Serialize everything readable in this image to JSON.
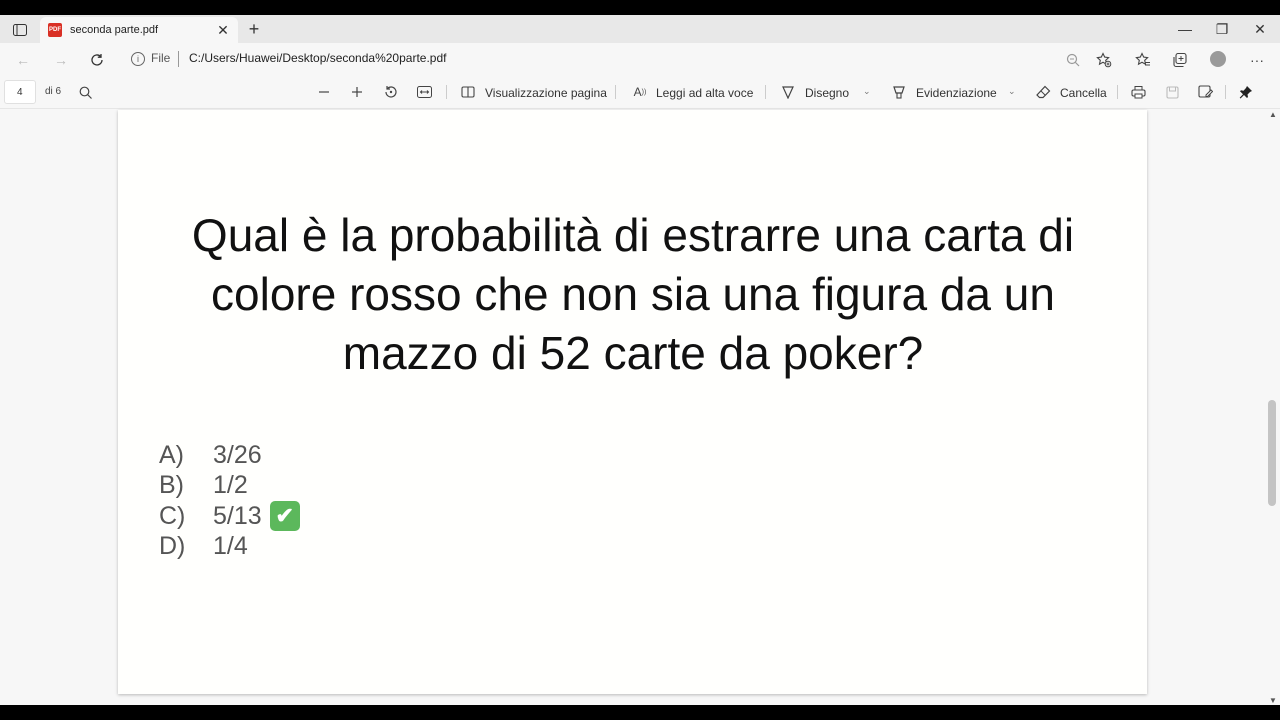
{
  "tab": {
    "title": "seconda parte.pdf",
    "close": "✕",
    "new_tab": "+"
  },
  "window_controls": {
    "minimize": "—",
    "maximize": "❐",
    "close": "✕"
  },
  "address": {
    "file_label": "File",
    "url": "C:/Users/Huawei/Desktop/seconda%20parte.pdf"
  },
  "pdf_toolbar": {
    "page_number": "4",
    "page_total": "di 6",
    "page_view": "Visualizzazione pagina",
    "read_aloud": "Leggi ad alta voce",
    "draw": "Disegno",
    "highlight": "Evidenziazione",
    "erase": "Cancella"
  },
  "document": {
    "question": "Qual è la probabilità di estrarre una carta di colore rosso che non sia una figura da un mazzo di 52 carte da poker?",
    "answers": [
      {
        "letter": "A)",
        "value": "3/26"
      },
      {
        "letter": "B)",
        "value": "1/2"
      },
      {
        "letter": "C)",
        "value": "5/13",
        "correct": true
      },
      {
        "letter": "D)",
        "value": "1/4"
      }
    ],
    "check_mark": "✔"
  }
}
